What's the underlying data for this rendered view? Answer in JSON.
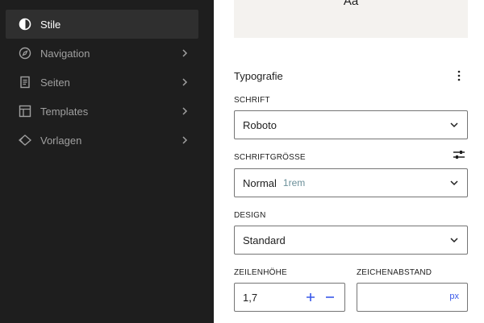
{
  "sidebar": {
    "items": [
      {
        "label": "Stile",
        "icon": "contrast-icon"
      },
      {
        "label": "Navigation",
        "icon": "compass-icon"
      },
      {
        "label": "Seiten",
        "icon": "page-icon"
      },
      {
        "label": "Templates",
        "icon": "layout-icon"
      },
      {
        "label": "Vorlagen",
        "icon": "symbol-icon"
      }
    ]
  },
  "preview": {
    "text": "Aa"
  },
  "typography": {
    "title": "Typografie",
    "font_label": "SCHRIFT",
    "font_value": "Roboto",
    "size_label": "SCHRIFTGRÖSSE",
    "size_value": "Normal",
    "size_hint": "1rem",
    "design_label": "DESIGN",
    "design_value": "Standard",
    "line_height_label": "ZEILENHÖHE",
    "line_height_value": "1,7",
    "letter_spacing_label": "ZEICHENABSTAND",
    "letter_spacing_unit": "px"
  },
  "colors": {
    "sidebar_bg": "#1e1e1e",
    "accent": "#3858e9"
  }
}
